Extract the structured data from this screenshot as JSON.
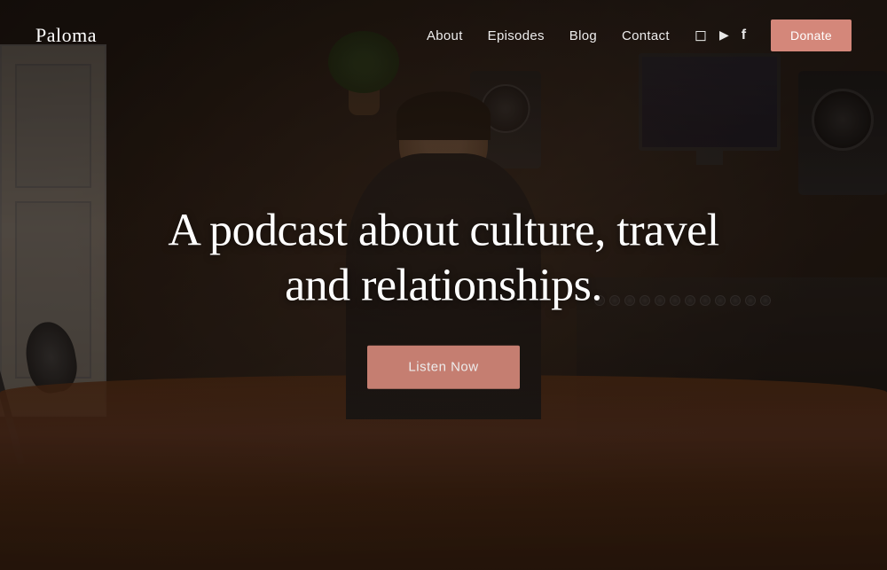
{
  "site": {
    "logo": "Paloma"
  },
  "nav": {
    "links": [
      {
        "label": "About",
        "id": "about"
      },
      {
        "label": "Episodes",
        "id": "episodes"
      },
      {
        "label": "Blog",
        "id": "blog"
      },
      {
        "label": "Contact",
        "id": "contact"
      }
    ],
    "donate_label": "Donate",
    "icons": [
      {
        "name": "instagram-icon",
        "symbol": "instagram"
      },
      {
        "name": "youtube-icon",
        "symbol": "youtube"
      },
      {
        "name": "facebook-icon",
        "symbol": "facebook"
      }
    ]
  },
  "hero": {
    "title": "A podcast about culture, travel and relationships.",
    "cta_label": "Listen Now"
  },
  "colors": {
    "accent": "#d4877a",
    "nav_text": "#ffffff",
    "hero_text": "#ffffff",
    "background": "#2a2420"
  }
}
